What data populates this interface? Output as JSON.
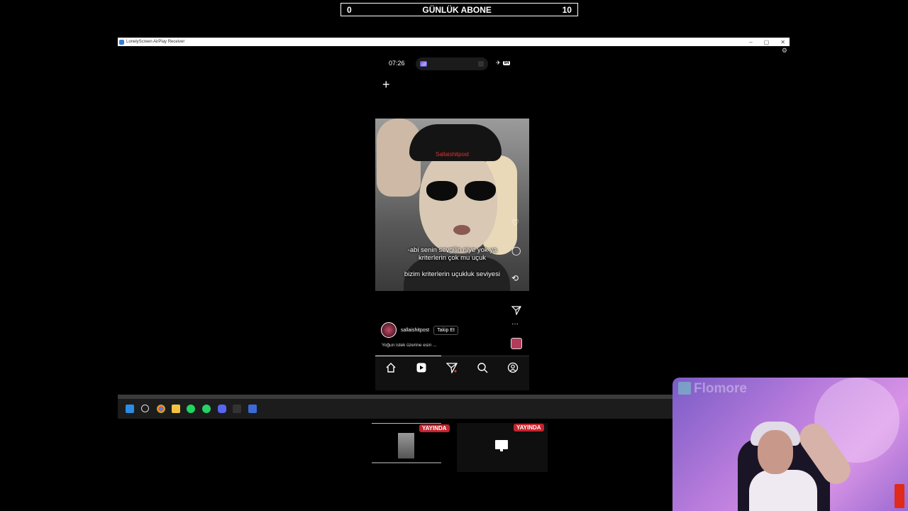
{
  "counter": {
    "left": "0",
    "title": "GÜNLÜK ABONE",
    "right": "10"
  },
  "window": {
    "title": "LonelyScreen AirPlay Receiver",
    "controls": [
      "–",
      "▢",
      "✕"
    ]
  },
  "phone": {
    "time": "07:26",
    "battery": "84",
    "subtitle_line1": "-abi senin sevgilin niye yok ya",
    "subtitle_line2": "kriterlerin çok mu uçuk",
    "subtitle_line3": "bizim kriterlerin uçukluk seviyesi",
    "hat_text": "Sallaishitpost",
    "username": "sallaishitpost",
    "follow_label": "Takip Et",
    "caption": "Yoğun istek üzerine esin ...",
    "video_progress": 0.43
  },
  "thumbnails": [
    {
      "badge": "YAYINDA"
    },
    {
      "badge": "YAYINDA"
    }
  ],
  "overlay": {
    "watermark": "Flomore"
  },
  "colors": {
    "live_badge": "#c6232e",
    "background": "#000000",
    "accent": "#3a6bd8"
  }
}
